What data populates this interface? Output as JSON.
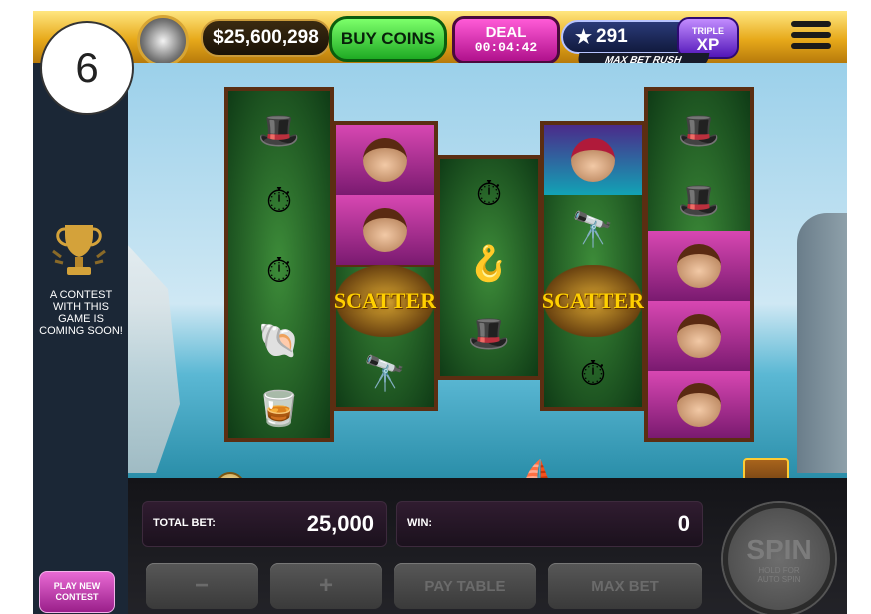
{
  "step_badge": "6",
  "topbar": {
    "coins": "$25,600,298",
    "coin_icon": "vault-coin-icon",
    "buy_coins": "BUY COINS",
    "deal_label": "DEAL",
    "deal_timer": "00:04:42",
    "stars": "291",
    "star_icon": "star-icon",
    "xp_top": "TRIPLE",
    "xp_main": "XP",
    "max_bet_rush": "MAX BET RUSH",
    "menu_icon": "hamburger-menu-icon"
  },
  "left_panel": {
    "trophy_icon": "trophy-icon",
    "contest_text": "A CONTEST WITH THIS GAME IS COMING SOON!",
    "play_new_contest": "PLAY NEW CONTEST"
  },
  "reels": {
    "scatter_label": "SCATTER",
    "symbols": [
      [
        "top-hat",
        "pocket-watch",
        "pocket-watch",
        "shell",
        "thimble"
      ],
      [
        "lady",
        "lady",
        "scatter",
        "spyglass"
      ],
      [
        "pocket-watch",
        "hook",
        "top-hat"
      ],
      [
        "mermaid",
        "spyglass",
        "scatter",
        "pocket-watch"
      ],
      [
        "top-hat",
        "top-hat",
        "lady",
        "lady",
        "lady"
      ]
    ]
  },
  "bottom": {
    "total_bet_label": "TOTAL BET:",
    "total_bet_value": "25,000",
    "win_label": "WIN:",
    "win_value": "0",
    "minus_label": "−",
    "plus_label": "+",
    "pay_table_label": "PAY TABLE",
    "max_bet_label": "MAX BET",
    "spin_label": "SPIN",
    "spin_hint": "HOLD FOR AUTO SPIN"
  },
  "colors": {
    "topbar_gold": "#e7a91a",
    "buy_coins_green": "#1faa24",
    "deal_pink": "#b0118c",
    "reel_green": "#0f3b16",
    "panel_navy": "#1b2736"
  }
}
